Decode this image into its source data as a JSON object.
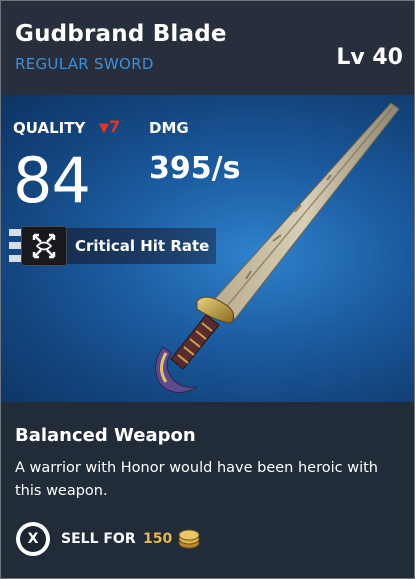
{
  "item": {
    "name": "Gudbrand Blade",
    "type": "REGULAR SWORD",
    "level": "Lv 40"
  },
  "stats": {
    "quality_label": "QUALITY",
    "quality_delta": "7",
    "quality_value": "84",
    "dmg_label": "DMG",
    "dmg_value": "395/s"
  },
  "perk": {
    "icon": "critical-hit-icon",
    "label": "Critical Hit Rate"
  },
  "description": {
    "title": "Balanced Weapon",
    "text": "A warrior with Honor would have been heroic with this weapon."
  },
  "sell": {
    "button_glyph": "X",
    "label": "SELL FOR",
    "price": "150",
    "currency_icon": "coin-icon"
  },
  "colors": {
    "rarity_blue": "#3c8fd9",
    "downgrade_red": "#e5331f",
    "price_gold": "#e6b84f"
  }
}
